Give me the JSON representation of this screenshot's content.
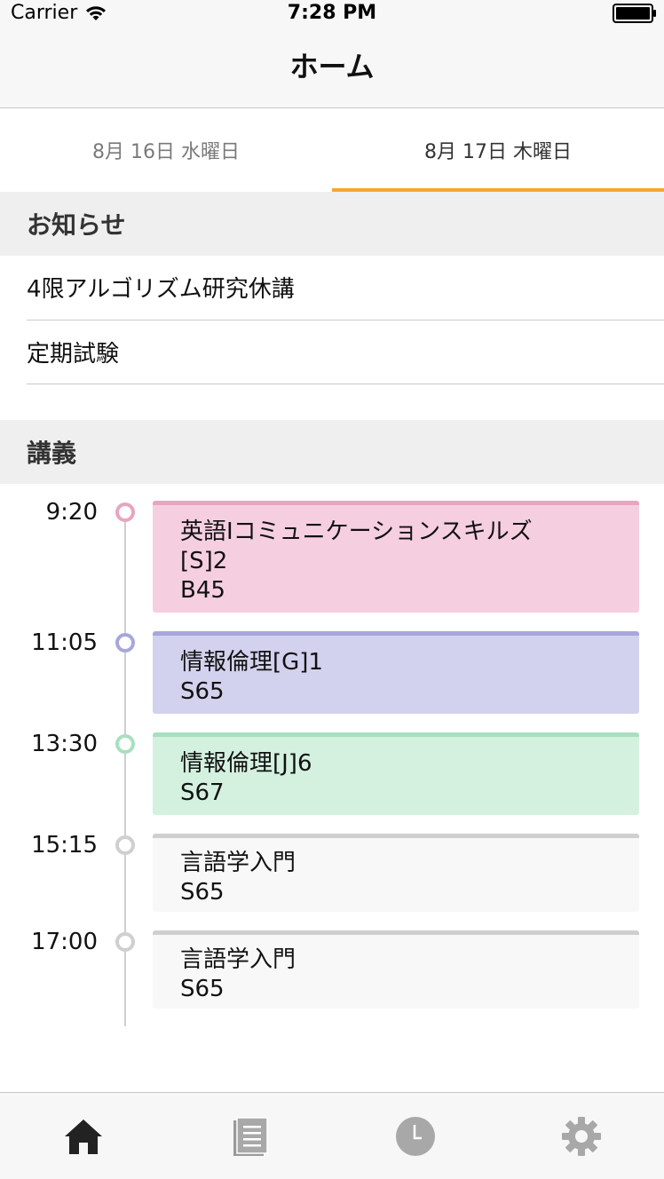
{
  "status_bar": {
    "carrier": "Carrier",
    "time": "7:28 PM"
  },
  "nav": {
    "title": "ホーム"
  },
  "date_tabs": [
    {
      "label": "8月 16日 水曜日",
      "selected": false
    },
    {
      "label": "8月 17日 木曜日",
      "selected": true
    }
  ],
  "colors": {
    "accent": "#f5a733"
  },
  "notices": {
    "header": "お知らせ",
    "items": [
      "4限アルゴリズム研究休講",
      "定期試験"
    ]
  },
  "lectures": {
    "header": "講義",
    "items": [
      {
        "time": "9:20",
        "lines": [
          "英語Iコミュニケーションスキルズ",
          "[S]2",
          "B45"
        ],
        "color": "#f5cfe0",
        "bar": "#e8a5be"
      },
      {
        "time": "11:05",
        "lines": [
          "情報倫理[G]1",
          "S65"
        ],
        "color": "#d2d2ee",
        "bar": "#a7a7dc"
      },
      {
        "time": "13:30",
        "lines": [
          "情報倫理[J]6",
          "S67"
        ],
        "color": "#d4f1e0",
        "bar": "#a9dfbf"
      },
      {
        "time": "15:15",
        "lines": [
          "言語学入門",
          "S65"
        ],
        "color": "#f8f8f8",
        "bar": "#cfcfcf"
      },
      {
        "time": "17:00",
        "lines": [
          "言語学入門",
          "S65"
        ],
        "color": "#f8f8f8",
        "bar": "#cfcfcf"
      }
    ]
  },
  "tab_bar": {
    "items": [
      {
        "icon": "home-icon",
        "selected": true
      },
      {
        "icon": "document-icon",
        "selected": false
      },
      {
        "icon": "clock-icon",
        "selected": false
      },
      {
        "icon": "gear-icon",
        "selected": false
      }
    ]
  }
}
